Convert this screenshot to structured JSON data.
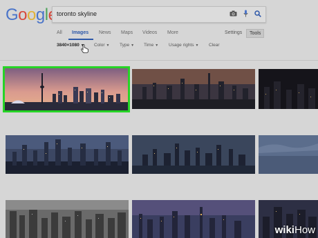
{
  "logo": {
    "letters": [
      "G",
      "o",
      "o",
      "g",
      "l",
      "e"
    ],
    "colors": [
      "#4a74c9",
      "#d64a3d",
      "#e0b23a",
      "#4a74c9",
      "#4ea35a",
      "#d64a3d"
    ]
  },
  "search": {
    "query": "toronto skyline"
  },
  "tabs": {
    "all": "All",
    "images": "Images",
    "news": "News",
    "maps": "Maps",
    "videos": "Videos",
    "more": "More",
    "settings": "Settings",
    "tools": "Tools"
  },
  "filters": {
    "size": "3840×1080",
    "color": "Color",
    "type": "Type",
    "time": "Time",
    "usage": "Usage rights",
    "clear": "Clear"
  },
  "icons": {
    "camera": "camera-icon",
    "mic": "mic-icon",
    "search": "search-icon",
    "cursor": "hand-cursor-icon"
  },
  "accent": "#2c57a8",
  "selection_color": "#26d426",
  "watermark": {
    "wiki": "wiki",
    "how": "How"
  }
}
